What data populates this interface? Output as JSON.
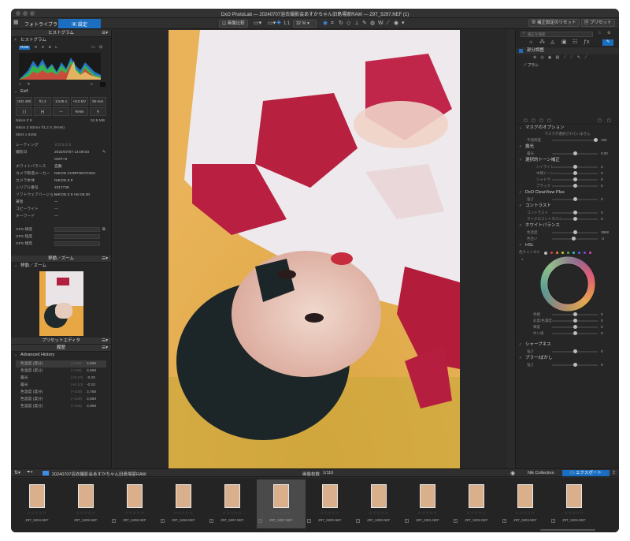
{
  "window": {
    "title": "DxO PhotoLab — 20240707浴衣撮影会あすかちゃん旧島場家RAW — Z9T_5297.NEF (1)"
  },
  "toolbar": {
    "tab_library": "フォトライブラリ",
    "tab_customize": "設定",
    "compare_btn": "画像比較",
    "zoom_ratio": "1:1",
    "zoom_level": "32 %",
    "reset_btn": "補正設定のリセット",
    "presets_btn": "プリセット"
  },
  "left": {
    "histogram_header": "ヒストグラム",
    "histogram_section": "ヒストグラム",
    "channels": [
      "RGB",
      "R",
      "G",
      "B",
      "L"
    ],
    "exif_header": "Exif",
    "exif_cells_row1": [
      "ISO 400",
      "f/1.2",
      "1/125 s",
      "+0.0 EV",
      "50 mm"
    ],
    "exif_cells_row2": [
      "",
      "",
      "—",
      "RAW",
      ""
    ],
    "camera": "Nikon Z 9",
    "file_size": "52.8 MB",
    "lens": "Nikon Z 50mm f/1.2 S (RAW)",
    "dimensions": "5504 x 8256",
    "meta_rows": [
      {
        "label": "レーティング",
        "value": "☆☆☆☆☆"
      },
      {
        "label": "撮影日",
        "value": "2024/07/07 14:09:03"
      },
      {
        "label": "",
        "value": "GMT+9"
      },
      {
        "label": "ホワイトバランス",
        "value": "自動"
      },
      {
        "label": "カメラ製造メーカー",
        "value": "NIKON CORPORATION"
      },
      {
        "label": "カメラ本体",
        "value": "NIKON Z 9"
      },
      {
        "label": "シリアル番号",
        "value": "2317739"
      },
      {
        "label": "ソフトウェアバージョン",
        "value": "NIKON Z 9 Ver.05.00"
      },
      {
        "label": "著者",
        "value": "—"
      },
      {
        "label": "コピーライト",
        "value": "—"
      },
      {
        "label": "キーワード",
        "value": "—"
      }
    ],
    "gps_rows": [
      "GPS 緯度",
      "GPS 経度",
      "GPS 標高"
    ],
    "nav_header": "移動／ズーム",
    "nav_section": "移動／ズーム",
    "preset_header": "プリセットエディタ",
    "history_header": "履歴",
    "history_section": "Advanced History",
    "history_items": [
      {
        "label": "色温度 (度分)",
        "from": "(+110)",
        "to": "3,668"
      },
      {
        "label": "色温度 (度分)",
        "from": "(+110)",
        "to": "3,668"
      },
      {
        "label": "露光",
        "from": "(+0.10)",
        "to": "-0.20"
      },
      {
        "label": "露光",
        "from": "(+0.10)",
        "to": "-0.10"
      },
      {
        "label": "色温度 (度分)",
        "from": "(+100)",
        "to": "3,768"
      },
      {
        "label": "色温度 (度分)",
        "from": "(+100)",
        "to": "3,868"
      },
      {
        "label": "色温度 (度分)",
        "from": "(+100)",
        "to": "3,968"
      }
    ]
  },
  "right": {
    "search_placeholder": "補正を検索",
    "local_adjust_label": "部分調整",
    "brush_label": "ブラシ",
    "mask_options_header": "マスクのオプション",
    "mask_options_note": "マスクが選択されていません",
    "opacity_label": "不透明度",
    "opacity_value": "100",
    "exposure_header": "露光",
    "exposure_label": "露光",
    "exposure_value": "0.00",
    "tone_header": "選択的トーン補正",
    "tone_rows": [
      {
        "label": "ハイライト",
        "value": "0"
      },
      {
        "label": "中間トーン",
        "value": "0"
      },
      {
        "label": "シャドウ",
        "value": "0"
      },
      {
        "label": "ブラック",
        "value": "0"
      }
    ],
    "clearview_header": "DxO ClearView Plus",
    "clearview_label": "強さ",
    "clearview_value": "0",
    "contrast_header": "コントラスト",
    "contrast_rows": [
      {
        "label": "コントラスト",
        "value": "0"
      },
      {
        "label": "マイクロコントラスト",
        "value": "0"
      }
    ],
    "wb_header": "ホワイトバランス",
    "wb_rows": [
      {
        "label": "色温度",
        "value": "3968"
      },
      {
        "label": "色合い",
        "value": "-3"
      }
    ],
    "hsl_header": "HSL",
    "hsl_label": "色チャンネル",
    "hsl_swatches": [
      "#d94040",
      "#e08a30",
      "#d8c93a",
      "#4fb04f",
      "#3fb7b7",
      "#3d6ee0",
      "#8a48d8",
      "#d848b0"
    ],
    "hsl_rows": [
      {
        "label": "色相",
        "value": "0"
      },
      {
        "label": "彩度/色濃度",
        "value": "0"
      },
      {
        "label": "輝度",
        "value": "0"
      },
      {
        "label": "ゆい値",
        "value": "0"
      }
    ],
    "sharpness_header": "シャープネス",
    "sharpness_label": "強さ",
    "sharpness_value": "0",
    "blur_header": "ブラー/ぼかし",
    "blur_label": "強さ",
    "blur_value": "0"
  },
  "filmbar": {
    "folder": "20240707浴衣撮影会あすかちゃん旧島場家RAW",
    "count_label": "画像枚数",
    "count_value": "1/110",
    "nik_btn": "Nik Collection",
    "export_btn": "エクスポート"
  },
  "filmstrip": [
    {
      "name": "Z9T_5294.NEF",
      "stars": "☆☆☆☆☆"
    },
    {
      "name": "Z9T_5295.NEF",
      "stars": "☆☆☆☆☆"
    },
    {
      "name": "Z9T_5296.NEF",
      "stars": "☆☆☆☆☆"
    },
    {
      "name": "Z9T_5296.NEF",
      "stars": "☆☆☆☆☆"
    },
    {
      "name": "Z9T_5297.NEF",
      "stars": "☆☆☆☆☆"
    },
    {
      "name": "Z9T_5297.NEF",
      "stars": "☆☆☆☆☆"
    },
    {
      "name": "Z9T_5300.NEF",
      "stars": "☆☆☆☆☆"
    },
    {
      "name": "Z9T_5300.NEF",
      "stars": "☆☆☆☆☆"
    },
    {
      "name": "Z9T_5301.NEF",
      "stars": "☆☆☆☆☆"
    },
    {
      "name": "Z9T_5302.NEF",
      "stars": "☆☆☆☆☆"
    },
    {
      "name": "Z9T_5303.NEF",
      "stars": "☆☆☆☆☆"
    },
    {
      "name": "Z9T_5304.NEF",
      "stars": "☆☆☆☆☆"
    }
  ],
  "icons": {
    "colors": {
      "accent": "#1b6ec0",
      "export": "#1b6ec0"
    }
  }
}
